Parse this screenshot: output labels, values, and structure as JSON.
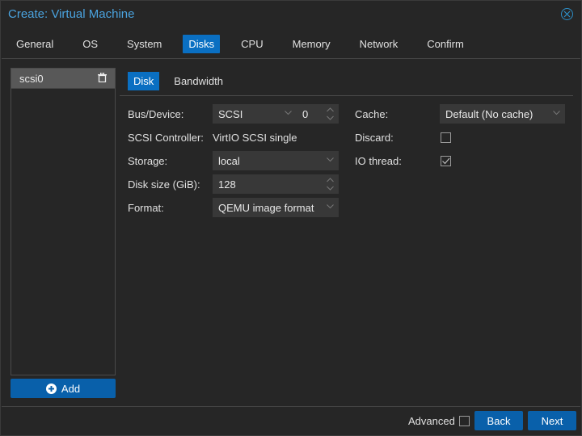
{
  "window": {
    "title": "Create: Virtual Machine"
  },
  "tabs": [
    {
      "label": "General",
      "active": false
    },
    {
      "label": "OS",
      "active": false
    },
    {
      "label": "System",
      "active": false
    },
    {
      "label": "Disks",
      "active": true
    },
    {
      "label": "CPU",
      "active": false
    },
    {
      "label": "Memory",
      "active": false
    },
    {
      "label": "Network",
      "active": false
    },
    {
      "label": "Confirm",
      "active": false
    }
  ],
  "disk_list": {
    "items": [
      {
        "label": "scsi0"
      }
    ],
    "add_label": "Add"
  },
  "subtabs": [
    {
      "label": "Disk",
      "active": true
    },
    {
      "label": "Bandwidth",
      "active": false
    }
  ],
  "form": {
    "bus_device": {
      "label": "Bus/Device:",
      "bus": "SCSI",
      "device": "0"
    },
    "scsi_controller": {
      "label": "SCSI Controller:",
      "value": "VirtIO SCSI single"
    },
    "storage": {
      "label": "Storage:",
      "value": "local"
    },
    "disk_size": {
      "label": "Disk size (GiB):",
      "value": "128"
    },
    "format": {
      "label": "Format:",
      "value": "QEMU image format"
    },
    "cache": {
      "label": "Cache:",
      "value": "Default (No cache)"
    },
    "discard": {
      "label": "Discard:",
      "checked": false
    },
    "io_thread": {
      "label": "IO thread:",
      "checked": true
    }
  },
  "footer": {
    "advanced_label": "Advanced",
    "advanced_checked": false,
    "back_label": "Back",
    "next_label": "Next"
  },
  "colors": {
    "accent": "#0a6fc2",
    "button": "#0960aa",
    "title": "#4aa3df"
  }
}
